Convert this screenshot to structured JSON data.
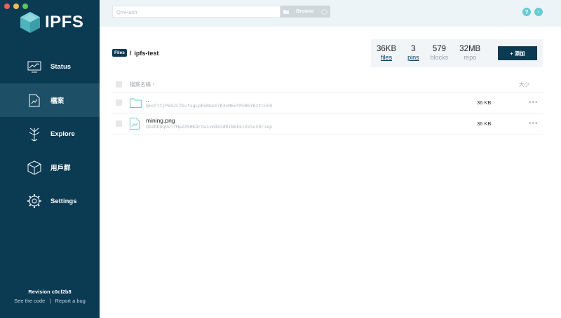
{
  "window": {
    "traffic_colors": [
      "#ee5f57",
      "#f5bd4f",
      "#5fc454"
    ]
  },
  "brand": {
    "name": "IPFS"
  },
  "sidebar": {
    "items": [
      {
        "label": "Status",
        "icon": "status-monitor-icon",
        "active": false
      },
      {
        "label": "檔案",
        "icon": "files-icon",
        "active": true
      },
      {
        "label": "Explore",
        "icon": "explore-tree-icon",
        "active": false
      },
      {
        "label": "用戶群",
        "icon": "peers-cube-icon",
        "active": false
      },
      {
        "label": "Settings",
        "icon": "settings-gear-icon",
        "active": false
      }
    ],
    "revision": "Revision c0cf2b8",
    "see_code": "See the code",
    "separator": "|",
    "report_bug": "Report a bug"
  },
  "topbar": {
    "search_placeholder": "QmHash",
    "browse_label": "Browse"
  },
  "breadcrumb": {
    "root": "Files",
    "sep": "/",
    "current": "ipfs-test"
  },
  "stats": [
    {
      "value": "36KB",
      "label": "files",
      "link": true
    },
    {
      "value": "3",
      "label": "pins",
      "link": true
    },
    {
      "value": "579",
      "label": "blocks",
      "link": false
    },
    {
      "value": "32MB",
      "label": "repo",
      "link": false
    }
  ],
  "add_button": {
    "label": "添加",
    "prefix": "+"
  },
  "table": {
    "name_header": "檔案名稱 ↑",
    "size_header": "大小",
    "rows": [
      {
        "type": "folder",
        "name": "..",
        "hash": "QmcFttjPVGJCTbvfsqLpPoRGeXrR3xM6xYPnRkYbzfcnF8",
        "size": "36 KB"
      },
      {
        "type": "file",
        "name": "mining.png",
        "hash": "QmZRDUq9vTfMpZ35HKDrtw1vm9X3dRiNVkkiXs5uCRriep",
        "size": "36 KB"
      }
    ],
    "more": "•••"
  },
  "colors": {
    "sidebar": "#0b3a53",
    "active": "#1d4f66",
    "accent": "#6acad1"
  }
}
